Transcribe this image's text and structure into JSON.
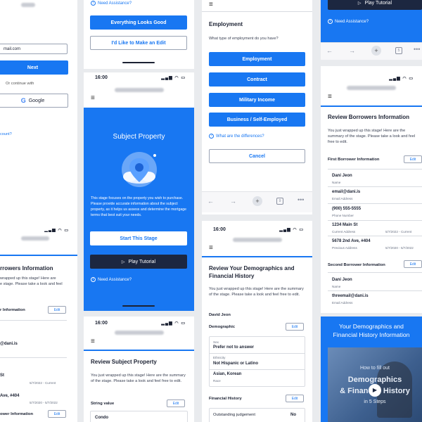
{
  "common": {
    "need_assistance": "Need Assistance?",
    "time": "16:00",
    "edit": "Edit",
    "review_intro": "You just wrapped up this stage! Here are the summary of the stage. Please take a look and feel free to edit."
  },
  "col1": {
    "email_value": "mail.com",
    "next_label": "Next",
    "continue_with": "Or continue with",
    "google_label": "Google",
    "account_link": "count?",
    "title": "rrowers Information",
    "intro_l1": "wrapped up this stage! Here are",
    "intro_l2": "e stage. Please take a look and feel",
    "section1": "r Information",
    "email_frag": "@dani.is",
    "phone_frag": "55-5555",
    "addr1_frag": "St",
    "addr1_date": "5/7/2022 - Current",
    "addr2_frag": "Ave, #404",
    "addr2_date": "5/7/2020 - 5/7/2022",
    "section2": "ower Information"
  },
  "col2": {
    "looks_good": "Everything Looks Good",
    "make_edit": "I'd Like to Make an Edit",
    "sp_title": "Subject Property",
    "sp_desc": "This stage focuses on the property you wish to purchase. Please provide accurate information about the subject property, as it helps us assess and determine the mortgage terms that best suit your needs.",
    "start_stage": "Start This Stage",
    "play_tutorial": "Play Tutorial",
    "review_title": "Review Subject Property",
    "string_value": "String value",
    "condo": "Condo"
  },
  "col3": {
    "emp_title": "Employment",
    "emp_question": "What type of employment do you have?",
    "options": [
      "Employment",
      "Contract",
      "Military Income",
      "Business / Self-Employed"
    ],
    "differences": "What are the differences?",
    "cancel": "Cancel",
    "tab_count": "9",
    "demo_title": "Review Your Demographics and Financial History",
    "name": "David Jeon",
    "demographic": "Demographic",
    "sex_label": "Sex",
    "sex_value": "Prefer not to answer",
    "eth_label": "Ethnicity",
    "eth_value": "Not Hispanic or Latino",
    "race_value": "Asian, Korean",
    "race_label": "Race",
    "fin_history": "Financial History",
    "judgement": "Outstanding judgement",
    "judgement_val": "No"
  },
  "col4": {
    "play_tutorial": "Play Tutorial",
    "tab_count": "5",
    "title": "Review Borrowers Information",
    "first_borrower": "First Borrower Information",
    "name1": "Dani Jeon",
    "name_label": "Name",
    "email1": "email@dani.is",
    "email_label": "Email Address",
    "phone": "(900) 555-5555",
    "phone_label": "Phone Number",
    "addr1": "1234 Main St",
    "addr1_label": "Current Address",
    "addr1_date": "5/7/2022 - Current",
    "addr2": "5678 2nd Ave, #404",
    "addr2_label": "Previous Address",
    "addr2_date": "5/7/2020 - 5/7/2022",
    "second_borrower": "Second Borrower Information",
    "name2": "Dani Jeon",
    "email2": "threemail@dani.is",
    "video_heading": "Your Demographics and Financial History Information",
    "video_small": "How to fill out",
    "video_big1": "Demographics",
    "video_big2": "& Financial History",
    "video_steps": "in 5 Steps"
  }
}
